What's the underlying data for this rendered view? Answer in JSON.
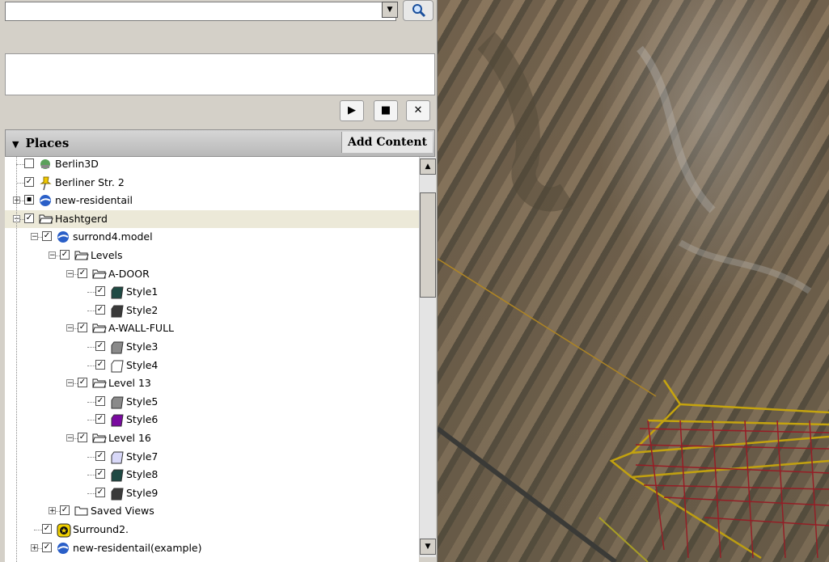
{
  "search": {
    "value": "",
    "placeholder": ""
  },
  "transport": {
    "play": "▶",
    "stop": "■",
    "close": "✕"
  },
  "places": {
    "title": "Places",
    "add_content": "Add Content"
  },
  "tree": [
    {
      "label": "Berlin3D",
      "depth": 1,
      "checked": false,
      "expander": "",
      "icon": "tour-icon"
    },
    {
      "label": "Berliner Str. 2",
      "depth": 1,
      "checked": true,
      "expander": "",
      "icon": "pushpin-icon"
    },
    {
      "label": "new-residentail",
      "depth": 1,
      "checked": "partial",
      "expander": "+",
      "icon": "model-icon"
    },
    {
      "label": "Hashtgerd",
      "depth": 1,
      "checked": true,
      "expander": "-",
      "icon": "folder-open-icon",
      "selected": true
    },
    {
      "label": "surrond4.model",
      "depth": 2,
      "checked": true,
      "expander": "-",
      "icon": "model-icon"
    },
    {
      "label": "Levels",
      "depth": 3,
      "checked": true,
      "expander": "-",
      "icon": "folder-open-icon"
    },
    {
      "label": "A-DOOR",
      "depth": 4,
      "checked": true,
      "expander": "-",
      "icon": "folder-open-icon"
    },
    {
      "label": "Style1",
      "depth": 5,
      "checked": true,
      "expander": "",
      "icon": "style-swatch-icon",
      "color": "#1f4a44"
    },
    {
      "label": "Style2",
      "depth": 5,
      "checked": true,
      "expander": "",
      "icon": "style-swatch-icon",
      "color": "#3a3a3a"
    },
    {
      "label": "A-WALL-FULL",
      "depth": 4,
      "checked": true,
      "expander": "-",
      "icon": "folder-open-icon"
    },
    {
      "label": "Style3",
      "depth": 5,
      "checked": true,
      "expander": "",
      "icon": "style-swatch-icon",
      "color": "#8a8a8a"
    },
    {
      "label": "Style4",
      "depth": 5,
      "checked": true,
      "expander": "",
      "icon": "style-swatch-icon",
      "color": "#ffffff"
    },
    {
      "label": "Level 13",
      "depth": 4,
      "checked": true,
      "expander": "-",
      "icon": "folder-open-icon"
    },
    {
      "label": "Style5",
      "depth": 5,
      "checked": true,
      "expander": "",
      "icon": "style-swatch-icon",
      "color": "#8a8a8a"
    },
    {
      "label": "Style6",
      "depth": 5,
      "checked": true,
      "expander": "",
      "icon": "style-swatch-icon",
      "color": "#7a0aa0"
    },
    {
      "label": "Level 16",
      "depth": 4,
      "checked": true,
      "expander": "-",
      "icon": "folder-open-icon"
    },
    {
      "label": "Style7",
      "depth": 5,
      "checked": true,
      "expander": "",
      "icon": "style-swatch-icon",
      "color": "#d8d8f8"
    },
    {
      "label": "Style8",
      "depth": 5,
      "checked": true,
      "expander": "",
      "icon": "style-swatch-icon",
      "color": "#1f4a44"
    },
    {
      "label": "Style9",
      "depth": 5,
      "checked": true,
      "expander": "",
      "icon": "style-swatch-icon",
      "color": "#3a3a3a"
    },
    {
      "label": "Saved Views",
      "depth": 3,
      "checked": true,
      "expander": "+",
      "icon": "folder-closed-icon"
    },
    {
      "label": "Surround2.",
      "depth": 2,
      "checked": true,
      "expander": "",
      "icon": "star-badge-icon"
    },
    {
      "label": "new-residentail(example)",
      "depth": 2,
      "checked": true,
      "expander": "+",
      "icon": "model-icon"
    }
  ]
}
